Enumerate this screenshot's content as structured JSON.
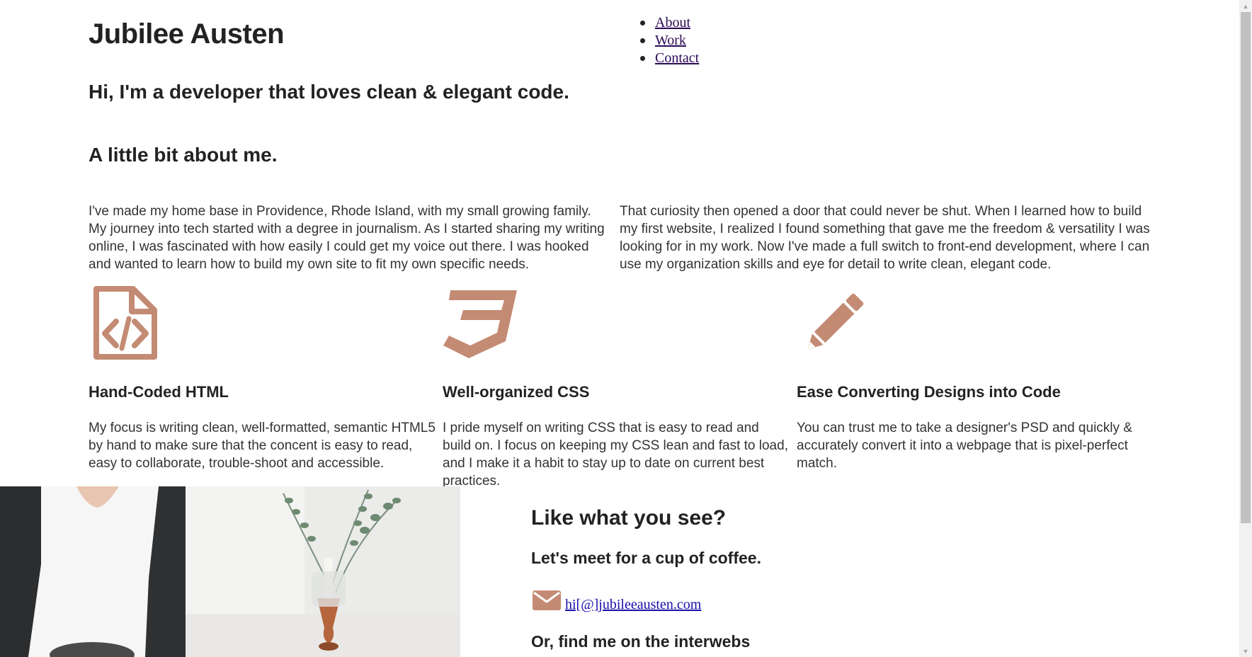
{
  "header": {
    "site_title": "Jubilee Austen",
    "nav": [
      {
        "label": "About"
      },
      {
        "label": "Work"
      },
      {
        "label": "Contact"
      }
    ]
  },
  "hero": {
    "tagline": "Hi, I'm a developer that loves clean & elegant code."
  },
  "about": {
    "heading": "A little bit about me.",
    "paragraphs": [
      "I've made my home base in Providence, Rhode Island, with my small growing family. My journey into tech started with a degree in journalism. As I started sharing my writing online, I was fascinated with how easily I could get my voice out there. I was hooked and wanted to learn how to build my own site to fit my own specific needs.",
      "That curiosity then opened a door that could never be shut. When I learned how to build my first website, I realized I found something that gave me the freedom & versatility I was looking for in my work. Now I've made a full switch to front-end development, where I can use my organization skills and eye for detail to write clean, elegant code."
    ]
  },
  "skills": [
    {
      "icon": "html-file-icon",
      "title": "Hand-Coded HTML",
      "text": "My focus is writing clean, well-formatted, semantic HTML5 by hand to make sure that the concent is easy to read, easy to collaborate, trouble-shoot and accessible."
    },
    {
      "icon": "css3-icon",
      "title": "Well-organized CSS",
      "text": "I pride myself on writing CSS that is easy to read and build on. I focus on keeping my CSS lean and fast to load, and I make it a habit to stay up to date on current best practices."
    },
    {
      "icon": "pencil-icon",
      "title": "Ease Converting Designs into Code",
      "text": "You can trust me to take a designer's PSD and quickly & accurately convert it into a webpage that is pixel-perfect match."
    }
  ],
  "contact": {
    "title": "Like what you see?",
    "subtitle": "Let's meet for a cup of coffee.",
    "email": "hi[@]jubileeausten.com",
    "social_heading": "Or, find me on the interwebs"
  },
  "colors": {
    "accent": "#c48b74",
    "text": "#222222",
    "link": "#1a0dab",
    "visited_link": "#2c0a55"
  }
}
